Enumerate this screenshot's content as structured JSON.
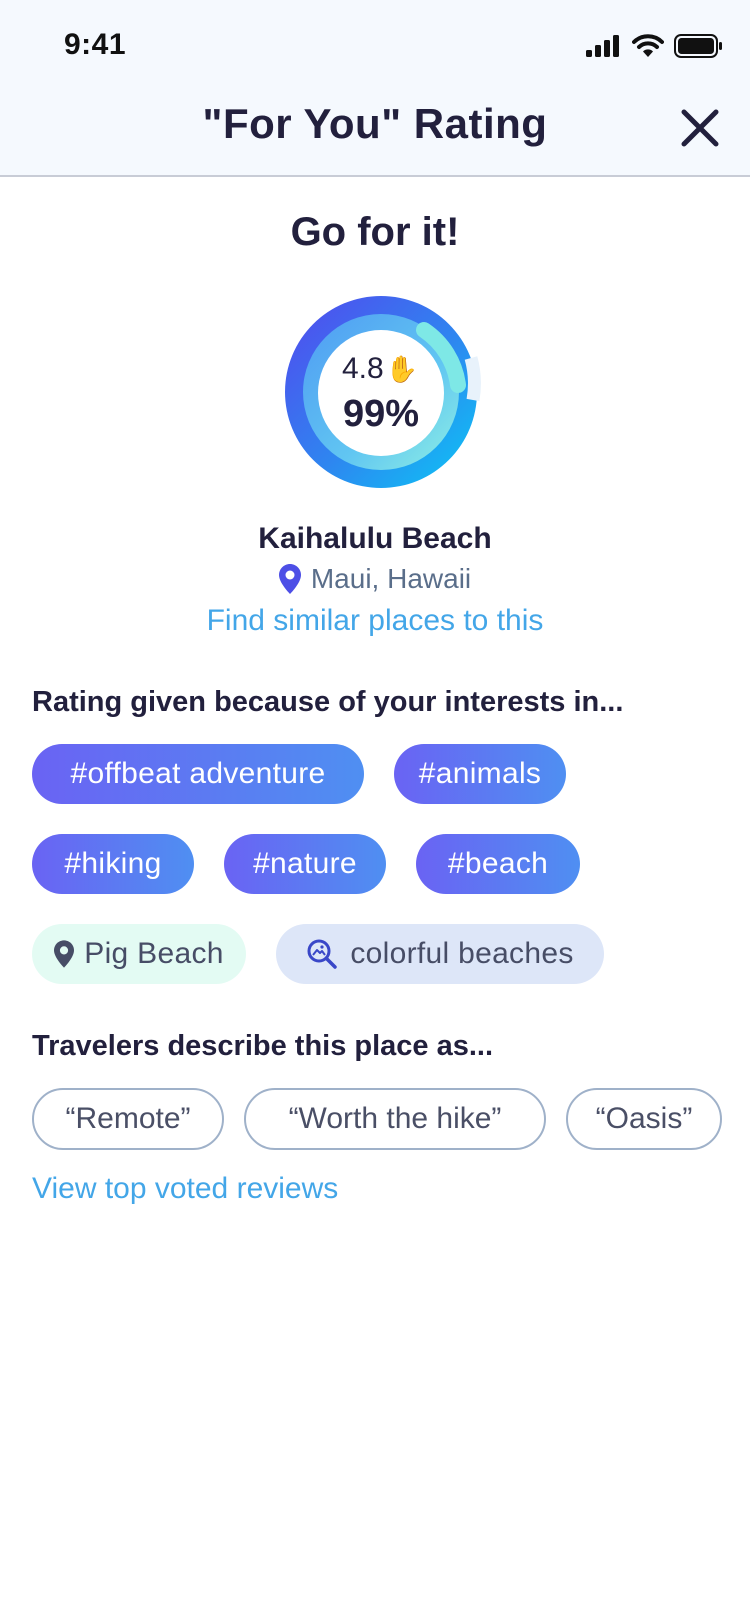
{
  "status_bar": {
    "time": "9:41"
  },
  "header": {
    "title": "\"For You\" Rating",
    "close_icon": "close-icon"
  },
  "verdict": "Go for it!",
  "rating": {
    "score": "4.8",
    "percent": "99%",
    "match_fraction": 0.99,
    "icon": "clapping-hands-icon"
  },
  "place": {
    "name": "Kaihalulu Beach",
    "location": "Maui, Hawaii",
    "location_icon": "map-pin-icon"
  },
  "find_similar_label": "Find similar places to this",
  "interests": {
    "title": "Rating given because of your interests in...",
    "tags": [
      "#offbeat adventure",
      "#animals",
      "#hiking",
      "#nature",
      "#beach"
    ],
    "place_chip": "Pig Beach",
    "search_chip": "colorful beaches"
  },
  "descriptions": {
    "title": "Travelers describe this place as...",
    "quotes": [
      "“Remote”",
      "“Worth the hike”",
      "“Oasis”"
    ]
  },
  "reviews_link": "View top voted reviews",
  "colors": {
    "accent_link": "#43a6e8",
    "tag_gradient_start": "#6a63f3",
    "tag_gradient_end": "#4f8ff2",
    "text_dark": "#22203d"
  }
}
